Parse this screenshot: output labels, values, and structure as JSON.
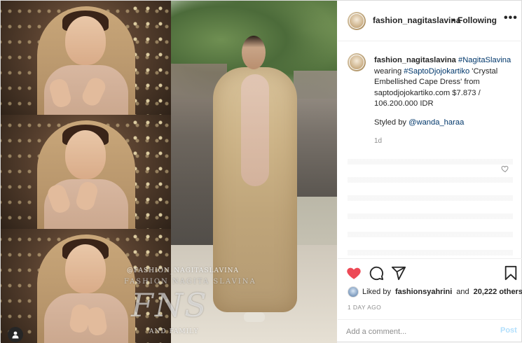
{
  "header": {
    "username": "fashion_nagitaslavina",
    "separator": "•",
    "follow_status": "Following",
    "more_icon": "more-horizontal-icon",
    "more_label": "•••"
  },
  "image": {
    "watermark_handle": "@FASHION_NAGITASLAVINA",
    "watermark_name": "FASHION NAGITA SLAVINA",
    "watermark_monogram": "FNS",
    "watermark_sub": "AND FAMILY"
  },
  "caption": {
    "username": "fashion_nagitaslavina",
    "hashtag": "#NagitaSlavina",
    "text1": " wearing ",
    "mention_brand": "#SaptoDjojokartiko",
    "text2": " 'Crystal Embellished Cape Dress' from saptodjojokartiko.com $7.873 / 106.200.000 IDR",
    "styled_prefix": "Styled by ",
    "styled_mention": "@wanda_haraa",
    "age": "1d"
  },
  "actions": {
    "like_icon": "heart-filled-icon",
    "comment_icon": "comment-icon",
    "share_icon": "share-icon",
    "save_icon": "bookmark-icon",
    "liked_color": "#ed4956"
  },
  "likes": {
    "prefix": "Liked by",
    "user": "fashionsyahrini",
    "middle": "and",
    "count": "20,222 others"
  },
  "timestamp": "1 DAY AGO",
  "comment": {
    "placeholder": "Add a comment...",
    "post_label": "Post"
  }
}
